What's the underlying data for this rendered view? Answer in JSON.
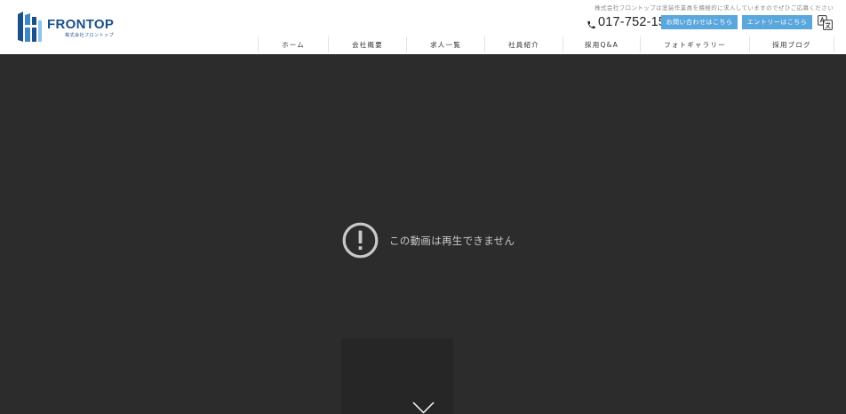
{
  "brand": {
    "name": "FRONTOP",
    "sub": "株式会社フロントップ"
  },
  "header": {
    "tagline": "株式会社フロントップは塗装作業員を積極的に求人していますのでぜひご応募ください",
    "tel": "017-752-1559",
    "contact_label": "お問い合わせはこちら",
    "entry_label": "エントリーはこちら"
  },
  "nav": {
    "items": [
      {
        "label": "ホーム"
      },
      {
        "label": "会社概要"
      },
      {
        "label": "求人一覧"
      },
      {
        "label": "社員紹介"
      },
      {
        "label": "採用Q&A"
      },
      {
        "label": "フォトギャラリー"
      },
      {
        "label": "採用ブログ"
      }
    ]
  },
  "video": {
    "error_message": "この動画は再生できません"
  },
  "colors": {
    "brand": "#1b4f8a",
    "accent": "#5aa7dd",
    "video_bg": "#2c2c2c"
  }
}
